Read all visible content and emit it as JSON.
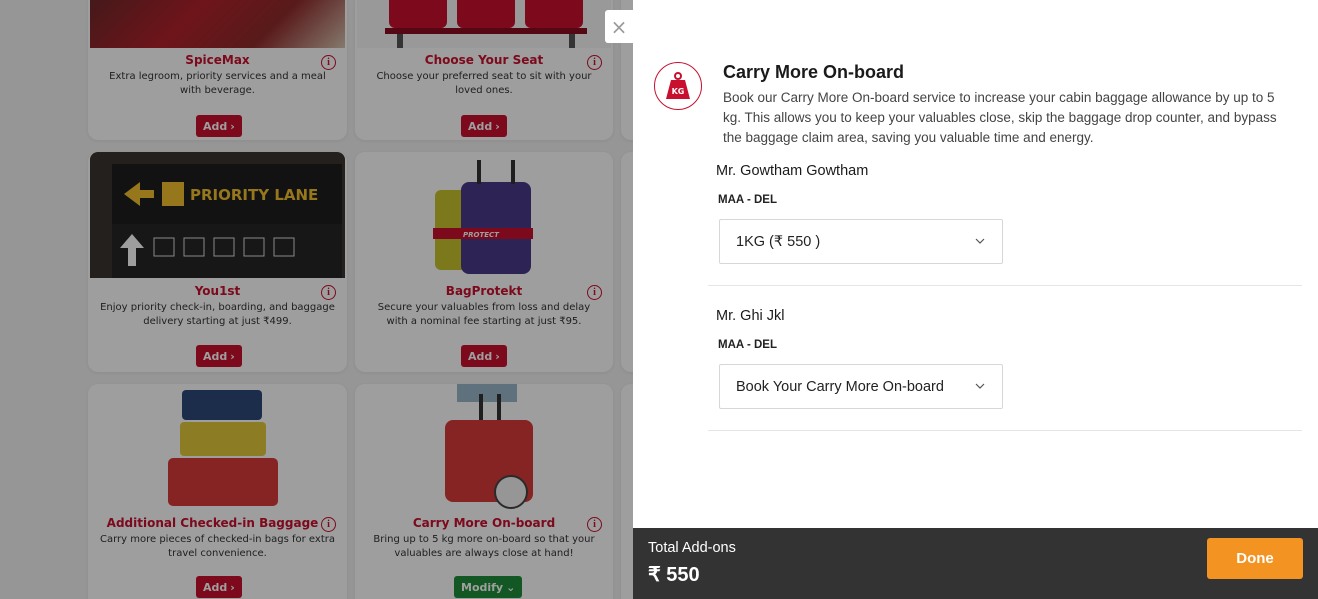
{
  "background": {
    "cards": [
      {
        "title": "SpiceMax",
        "desc": "Extra legroom, priority services and a meal with beverage.",
        "button": "Add"
      },
      {
        "title": "Choose Your Seat",
        "desc": "Choose your preferred seat to sit with your loved ones.",
        "button": "Add"
      },
      {
        "title": "You1st",
        "desc": "Enjoy priority check-in, boarding, and baggage delivery starting at just ₹499.",
        "button": "Add",
        "image_text": "PRIORITY LANE"
      },
      {
        "title": "BagProtekt",
        "desc": "Secure your valuables from loss and delay with a nominal fee starting at just ₹95.",
        "button": "Add",
        "image_text": "PROTECT"
      },
      {
        "title": "Additional Checked-in Baggage",
        "desc": "Carry more pieces of checked-in bags for extra travel convenience.",
        "button": "Add"
      },
      {
        "title": "Carry More On-board",
        "desc": "Bring up to 5 kg more on-board so that your valuables are always close at hand!",
        "button": "Modify"
      }
    ]
  },
  "panel": {
    "close_icon": "×",
    "icon_text": "KG",
    "title": "Carry More On-board",
    "description": "Book our Carry More On-board service to increase your cabin baggage allowance by up to 5 kg. This allows you to keep your valuables close, skip the baggage drop counter, and bypass the baggage claim area, saving you valuable time and energy.",
    "passengers": [
      {
        "name": "Mr. Gowtham Gowtham",
        "route": "MAA - DEL",
        "selection": "1KG (₹ 550 )"
      },
      {
        "name": "Mr. Ghi Jkl",
        "route": "MAA - DEL",
        "selection": "Book Your Carry More On-board"
      }
    ],
    "footer": {
      "total_label": "Total Add-ons",
      "total_value": "₹ 550",
      "done_label": "Done"
    }
  },
  "colors": {
    "brand_red": "#c8102e",
    "accent_orange": "#f39321",
    "footer_bg": "#333333",
    "modify_green": "#1f8f3a"
  }
}
